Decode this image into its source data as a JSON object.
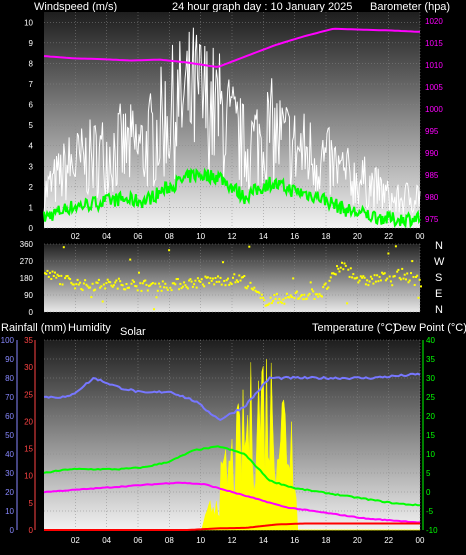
{
  "header": {
    "windspeed_label": "Windspeed (m/s)",
    "title": "24 hour graph day : 10 January 2025",
    "barometer_label": "Barometer (hpa)"
  },
  "compass": {
    "labels": [
      "N",
      "W",
      "S",
      "E",
      "N"
    ]
  },
  "lower_header": {
    "rainfall_label": "Rainfall (mm)",
    "humidity_label": "Humidity",
    "solar_label": "Solar",
    "temperature_label": "Temperature (°C)",
    "dewpoint_label": "Dew Point (°C)"
  },
  "colors": {
    "wind_avg": "#00ff00",
    "wind_gust": "#ffffff",
    "barometer": "#ff00ff",
    "direction": "#ffff00",
    "humidity": "#7777ff",
    "solar": "#ffff00",
    "temperature": "#00ff00",
    "dewpoint": "#ff00ff",
    "rain": "#ff0000",
    "rain_axis": "#ff4444",
    "humidity_axis": "#8888ff",
    "temp_axis": "#00ff00",
    "baro_axis": "#ff00ff"
  },
  "chart_data": [
    {
      "type": "line",
      "title": "24 hour graph day : 10 January 2025",
      "x": [
        0,
        2,
        4,
        6,
        8,
        10,
        12,
        14,
        16,
        18,
        20,
        22,
        24
      ],
      "x_tick_labels": [
        "02",
        "04",
        "06",
        "08",
        "10",
        "12",
        "14",
        "16",
        "18",
        "20",
        "22",
        "00"
      ],
      "series": [
        {
          "name": "Windspeed (m/s)",
          "axis": "left",
          "values": [
            0.5,
            1.0,
            1.2,
            1.4,
            1.3,
            2.0,
            2.6,
            2.5,
            1.5,
            2.2,
            1.8,
            1.5,
            0.9,
            0.6,
            0.4,
            0.5
          ]
        },
        {
          "name": "gust",
          "axis": "left",
          "values": [
            2.0,
            3.5,
            4.0,
            4.5,
            4.5,
            6.5,
            7.5,
            6.5,
            4.5,
            5.5,
            4.5,
            4.0,
            3.0,
            2.5,
            1.5,
            2.0
          ]
        },
        {
          "name": "Barometer (hpa)",
          "axis": "right",
          "values": [
            1012,
            1011.5,
            1011.3,
            1011.0,
            1011.2,
            1010.5,
            1009.5,
            1012.0,
            1014.5,
            1016.5,
            1018.2,
            1018.0,
            1017.8,
            1017.5
          ]
        }
      ],
      "y_left": {
        "label": "Windspeed (m/s)",
        "ticks": [
          "0",
          "1",
          "2",
          "3",
          "4",
          "5",
          "6",
          "7",
          "8",
          "9",
          "10"
        ],
        "ylim": [
          0,
          10.5
        ]
      },
      "y_right": {
        "label": "Barometer (hpa)",
        "ticks": [
          "975",
          "980",
          "985",
          "990",
          "995",
          "1000",
          "1005",
          "1010",
          "1015",
          "1020"
        ],
        "ylim": [
          973,
          1022
        ]
      },
      "grid": true
    },
    {
      "type": "scatter",
      "series": [
        {
          "name": "direction",
          "values": [
            200,
            170,
            140,
            145,
            150,
            140,
            140,
            150,
            160,
            170,
            175,
            60,
            70,
            90,
            100,
            250,
            160,
            180,
            200,
            160
          ]
        }
      ],
      "y_left": {
        "ticks": [
          "0",
          "90",
          "180",
          "270",
          "360"
        ],
        "ylim": [
          0,
          360
        ]
      },
      "y_right": {
        "labels": [
          "N",
          "W",
          "S",
          "E",
          "N"
        ]
      },
      "grid": true
    },
    {
      "type": "line",
      "series": [
        {
          "name": "Humidity",
          "axis": "humidity",
          "values": [
            70,
            70,
            80,
            75,
            72,
            73,
            68,
            58,
            65,
            80,
            80,
            80,
            80,
            80,
            81,
            82
          ]
        },
        {
          "name": "Solar",
          "axis": "solar",
          "values": [
            0,
            0,
            0,
            0,
            0,
            0,
            30,
            60,
            40,
            20,
            15,
            0,
            0
          ]
        },
        {
          "name": "Temperature (°C)",
          "axis": "temperature",
          "values": [
            5,
            6,
            6,
            6,
            6.5,
            8,
            11,
            12,
            10,
            3,
            1,
            0,
            -1,
            -2,
            -3,
            -3.5
          ]
        },
        {
          "name": "Dew Point (°C)",
          "axis": "temperature",
          "values": [
            0,
            0.5,
            1,
            1.5,
            2,
            2.5,
            2,
            0,
            -2,
            -4,
            -5,
            -6,
            -7,
            -7.5,
            -8
          ]
        },
        {
          "name": "Rainfall (mm)",
          "axis": "rain",
          "values": [
            0,
            0,
            0,
            0,
            0,
            0,
            0.3,
            0.4,
            1.0,
            1.2,
            1.2,
            1.2,
            1.2,
            1.2
          ]
        }
      ],
      "y_rain": {
        "label": "Rainfall (mm)",
        "ticks": [
          "0",
          "5",
          "10",
          "15",
          "20",
          "25",
          "30",
          "35"
        ]
      },
      "y_humidity": {
        "label": "Humidity",
        "ticks": [
          "0",
          "10",
          "20",
          "30",
          "40",
          "50",
          "60",
          "70",
          "80",
          "90",
          "100"
        ]
      },
      "y_temperature": {
        "label": "Temperature (°C)",
        "ticks": [
          "-10",
          "-5",
          "0",
          "5",
          "10",
          "15",
          "20",
          "25",
          "30",
          "35",
          "40"
        ]
      },
      "grid": true
    }
  ]
}
